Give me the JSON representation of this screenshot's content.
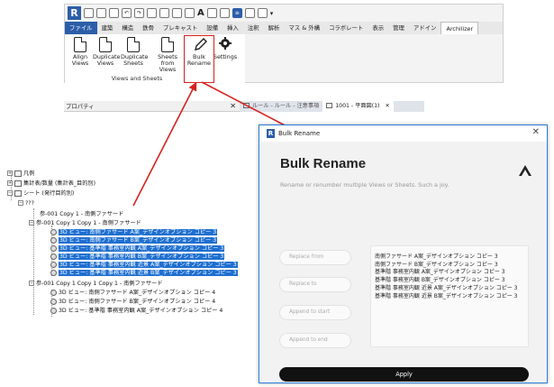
{
  "ribbon": {
    "tabs": [
      "ファイル",
      "建築",
      "構造",
      "鉄骨",
      "プレキャスト",
      "設備",
      "挿入",
      "注釈",
      "解析",
      "マス & 外構",
      "コラボレート",
      "表示",
      "管理",
      "アドイン",
      "Archilizer"
    ],
    "tools": [
      {
        "line1": "Align",
        "line2": "Views"
      },
      {
        "line1": "Duplicate",
        "line2": "Views"
      },
      {
        "line1": "Duplicate",
        "line2": "Sheets"
      },
      {
        "line1": "Sheets",
        "line2": "from Views"
      },
      {
        "line1": "Bulk",
        "line2": "Rename"
      },
      {
        "line1": "Settings",
        "line2": ""
      }
    ],
    "panel_title": "Views and Sheets"
  },
  "properties": {
    "label": "プロパティ",
    "close": "✕"
  },
  "view_tabs": [
    {
      "label": "ルール - ルール - 注意事項",
      "close": ""
    },
    {
      "label": "1001 - 平面図(1)",
      "close": "✕"
    }
  ],
  "tree": {
    "rows": [
      {
        "text": "凡例",
        "sel": false
      },
      {
        "text": "集計表/数量 (集計表_目的別)",
        "sel": false
      },
      {
        "text": "シート (発行目的別)",
        "sel": false
      },
      {
        "text": "???",
        "sel": false
      },
      {
        "text": "参-001 Copy 1 - 南側ファサード",
        "sel": false
      },
      {
        "text": "参-001 Copy 1 Copy 1 - 南側ファサード",
        "sel": false
      },
      {
        "text": "3D ビュー: 南側ファサード A案_デザインオプション コピー 3",
        "sel": true
      },
      {
        "text": "3D ビュー: 南側ファサード B案_デザインオプション コピー 3",
        "sel": true
      },
      {
        "text": "3D ビュー: 基準階 事務室内観 A案_デザインオプション コピー 3",
        "sel": true
      },
      {
        "text": "3D ビュー: 基準階 事務室内観 B案_デザインオプション コピー 3",
        "sel": true
      },
      {
        "text": "3D ビュー: 基準階 事務室内観 近景 A案_デザインオプション コピー 3",
        "sel": true
      },
      {
        "text": "3D ビュー: 基準階 事務室内観 近景 B案_デザインオプション コピー 3",
        "sel": true
      },
      {
        "text": "参-001 Copy 1 Copy 1 Copy 1 - 南側ファサード",
        "sel": false
      },
      {
        "text": "3D ビュー: 南側ファサード A案_デザインオプション コピー 4",
        "sel": false
      },
      {
        "text": "3D ビュー: 南側ファサード B案_デザインオプション コピー 4",
        "sel": false
      },
      {
        "text": "3D ビュー: 基準階 事務室内観 A案_デザインオプション コピー 4",
        "sel": false
      }
    ]
  },
  "dialog": {
    "window_title": "Bulk Rename",
    "close": "✕",
    "heading": "Bulk Rename",
    "subtitle": "Rename or renumber multiple Views or Sheets. Such a joy.",
    "fields": {
      "replace_from": "Replace from",
      "replace_to": "Replace to",
      "append_start": "Append to start",
      "append_end": "Append to end"
    },
    "preview": [
      "南側ファサード A案_デザインオプション コピー 3",
      "南側ファサード B案_デザインオプション コピー 3",
      "基準階 事務室内観 A案_デザインオプション コピー 3",
      "基準階 事務室内観 B案_デザインオプション コピー 3",
      "基準階 事務室内観 近景 A案_デザインオプション コピー 3",
      "基準階 事務室内観 近景 B案_デザインオプション コピー 3"
    ],
    "apply": "Apply"
  },
  "colors": {
    "accent": "#2c5ea8",
    "selection": "#1e6fd0",
    "annotation": "#d6221e",
    "apply_bg": "#111111"
  }
}
